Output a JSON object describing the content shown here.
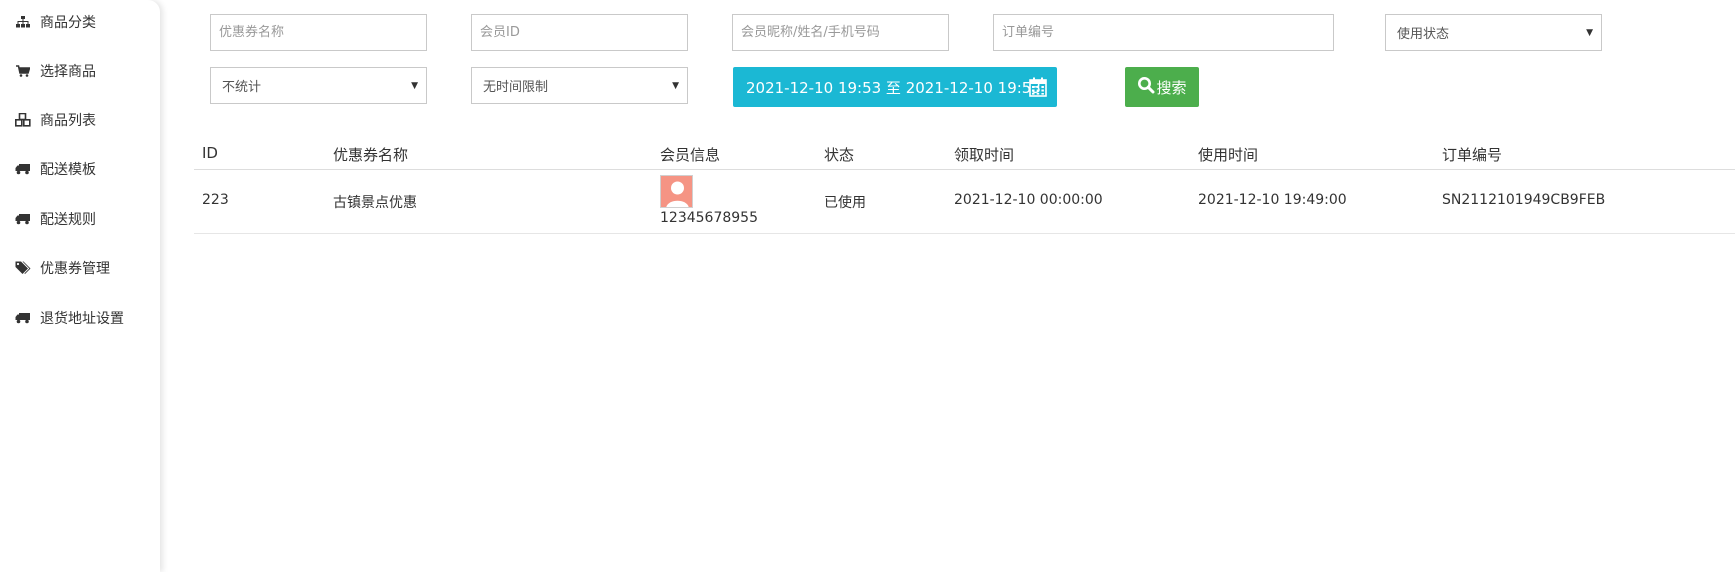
{
  "sidebar": {
    "items": [
      {
        "label": "商品分类",
        "icon": "sitemap-icon"
      },
      {
        "label": "选择商品",
        "icon": "cart-icon"
      },
      {
        "label": "商品列表",
        "icon": "cubes-icon"
      },
      {
        "label": "配送模板",
        "icon": "truck-icon"
      },
      {
        "label": "配送规则",
        "icon": "truck-icon"
      },
      {
        "label": "优惠券管理",
        "icon": "tags-icon"
      },
      {
        "label": "退货地址设置",
        "icon": "truck-icon"
      }
    ]
  },
  "filters": {
    "coupon_name_placeholder": "优惠券名称",
    "member_id_placeholder": "会员ID",
    "member_info_placeholder": "会员昵称/姓名/手机号码",
    "order_no_placeholder": "订单编号",
    "use_status_selected": "使用状态",
    "stat_selected": "不统计",
    "time_limit_selected": "无时间限制",
    "date_range": "2021-12-10 19:53 至 2021-12-10 19:53",
    "search_label": "搜索"
  },
  "colors": {
    "date_range_bg": "#1bb8d4",
    "search_bg": "#4cae4c",
    "avatar_bg": "#f59484"
  },
  "table": {
    "headers": [
      "ID",
      "优惠券名称",
      "会员信息",
      "状态",
      "领取时间",
      "使用时间",
      "订单编号"
    ],
    "rows": [
      {
        "id": "223",
        "coupon_name": "古镇景点优惠",
        "member": "12345678955",
        "status": "已使用",
        "receive_time": "2021-12-10 00:00:00",
        "use_time": "2021-12-10 19:49:00",
        "order_no": "SN2112101949CB9FEB"
      }
    ]
  }
}
